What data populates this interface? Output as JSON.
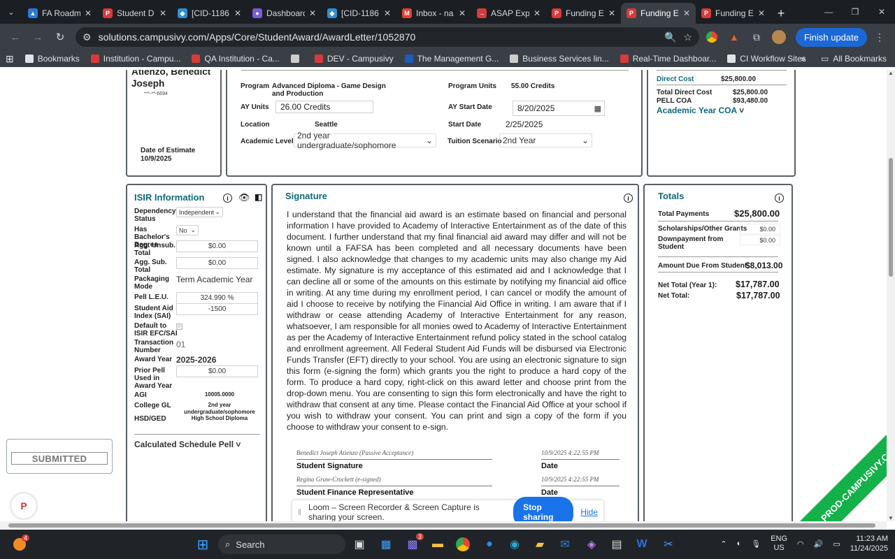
{
  "browser": {
    "tabs": [
      {
        "label": "FA Roadm",
        "color": "#2b7bd6",
        "glyph": "▲"
      },
      {
        "label": "Student D",
        "color": "#d63a3a",
        "glyph": "P"
      },
      {
        "label": "[CID-1186",
        "color": "#2f8fd6",
        "glyph": "◆"
      },
      {
        "label": "Dashboard",
        "color": "#7b5cd6",
        "glyph": "●"
      },
      {
        "label": "[CID-1186",
        "color": "#2f8fd6",
        "glyph": "◆"
      },
      {
        "label": "Inbox - na",
        "color": "#e34133",
        "glyph": "M"
      },
      {
        "label": "ASAP Expr",
        "color": "#d63a3a",
        "glyph": "→"
      },
      {
        "label": "Funding E",
        "color": "#d63a3a",
        "glyph": "P"
      },
      {
        "label": "Funding E",
        "color": "#d63a3a",
        "glyph": "P",
        "active": true
      },
      {
        "label": "Funding E",
        "color": "#d63a3a",
        "glyph": "P"
      }
    ],
    "url": "solutions.campusivy.com/Apps/Core/StudentAward/AwardLetter/1052870",
    "finish_update": "Finish update",
    "bookmarks": [
      {
        "label": "Bookmarks",
        "color": "#e0e3e6"
      },
      {
        "label": "Institution - Campu...",
        "color": "#d63a3a"
      },
      {
        "label": "QA Institution - Ca...",
        "color": "#d63a3a"
      },
      {
        "label": "",
        "color": "#cccccc"
      },
      {
        "label": "DEV - Campusivy",
        "color": "#d63a3a"
      },
      {
        "label": "The Management G...",
        "color": "#1f5bb8"
      },
      {
        "label": "Business Services lin...",
        "color": "#cccccc"
      },
      {
        "label": "Real-Time Dashboar...",
        "color": "#d63a3a"
      },
      {
        "label": "CI Workflow Sites",
        "color": "#e0e3e6"
      }
    ],
    "all_bookmarks": "All Bookmarks"
  },
  "student": {
    "name_line1": "Atienzo, Benedict",
    "name_line2": "Joseph",
    "ssn": "***-**-6694",
    "date_of_estimate_label": "Date of Estimate",
    "date_of_estimate": "10/9/2025"
  },
  "program": {
    "program_label": "Program",
    "program_value": "Advanced Diploma - Game Design and Production",
    "ay_units_label": "AY Units",
    "ay_units_value": "26.00 Credits",
    "location_label": "Location",
    "location_value": "Seattle",
    "academic_level_label": "Academic Level",
    "academic_level_value": "2nd year undergraduate/sophomore",
    "program_units_label": "Program Units",
    "program_units_value": "55.00 Credits",
    "ay_start_label": "AY Start Date",
    "ay_start_value": "8/20/2025",
    "start_date_label": "Start Date",
    "start_date_value": "2/25/2025",
    "tuition_scenario_label": "Tuition Scenario",
    "tuition_scenario_value": "2nd Year"
  },
  "coa": {
    "direct_cost_label": "Direct Cost",
    "direct_cost_value": "$25,800.00",
    "total_direct_cost_label": "Total Direct Cost",
    "total_direct_cost_value": "$25,800.00",
    "pell_coa_label": "PELL COA",
    "pell_coa_value": "$93,480.00",
    "academic_year_coa": "Academic Year COA"
  },
  "isir": {
    "title": "ISIR Information",
    "rows": [
      {
        "label": "Dependency Status",
        "value": "Independent"
      },
      {
        "label": "Has Bachelor's Degree",
        "value": "No"
      },
      {
        "label": "Agg. Unsub. Total",
        "value": "$0.00"
      },
      {
        "label": "Agg. Sub. Total",
        "value": "$0.00"
      },
      {
        "label": "Packaging Mode",
        "value": "Term Academic Year"
      },
      {
        "label": "Pell L.E.U.",
        "value": "324.990 %"
      },
      {
        "label": "Student Aid Index (SAI)",
        "value": "-1500"
      },
      {
        "label": "Default to ISIR EFC/SAI",
        "value": ""
      },
      {
        "label": "Transaction Number",
        "value": "01"
      },
      {
        "label": "Award Year",
        "value": "2025-2026"
      },
      {
        "label": "Prior Pell Used in Award Year",
        "value": "$0.00"
      },
      {
        "label": "AGI",
        "value": "10005.0000"
      },
      {
        "label": "College GL",
        "value": "2nd year undergraduate/sophomore"
      },
      {
        "label": "HSD/GED",
        "value": "High School Diploma"
      }
    ],
    "calculated_schedule": "Calculated Schedule Pell"
  },
  "signature": {
    "title": "Signature",
    "body": "I understand that the financial aid award is an estimate based on financial and personal information I have provided to Academy of Interactive Entertainment as of the date of this document. I further understand that my final financial aid award may differ and will not be known until a FAFSA has been completed and all necessary documents have been signed. I also acknowledge that changes to my academic units may also change my Aid estimate. My signature is my acceptance of this estimated aid and I acknowledge that I can decline all or some of the amounts on this estimate by notifying my financial aid office in writing.  At any time during my enrollment period, I can cancel or modify the amount of aid I choose to receive by notifying the Financial Aid Office in writing.  I am aware that if I withdraw or cease attending Academy of Interactive Entertainment for any reason, whatsoever, I am responsible for all monies owed to Academy of Interactive Entertainment as per the Academy of Interactive Entertainment refund policy stated in the school catalog and enrollment agreement. All Federal Student Aid Funds will be disbursed via Electronic Funds Transfer (EFT) directly to your school.  You are using an electronic signature to sign this form (e-signing the form) which grants you the right to produce a hard copy of the form. To produce a hard copy, right-click on this award letter and choose print from the drop-down menu.  You are consenting to sign this form electronically and have the right to withdraw that consent at any time.  Please contact the Financial Aid Office at your school if you wish to withdraw your consent.  You can print and sign a copy of the form if you choose to withdraw your consent to e-sign.",
    "student_signer": "Benedict Joseph Atienzo (Passive Acceptance)",
    "student_date": "10/9/2025 4:22:55 PM",
    "student_label": "Student Signature",
    "date_label": "Date",
    "rep_signer": "Regina Graw-Crockett (e-signed)",
    "rep_date": "10/9/2025 4:22:55 PM",
    "rep_label": "Student Finance Representative"
  },
  "totals": {
    "title": "Totals",
    "total_payments_label": "Total Payments",
    "total_payments_value": "$25,800.00",
    "scholarships_label": "Scholarships/Other Grants",
    "scholarships_value": "$0.00",
    "downpayment_label": "Downpayment from Student",
    "downpayment_value": "$0.00",
    "amount_due_label": "Amount Due From Student",
    "amount_due_value": "$8,013.00",
    "net_year1_label": "Net Total (Year 1):",
    "net_year1_value": "$17,787.00",
    "net_total_label": "Net Total:",
    "net_total_value": "$17,787.00"
  },
  "submitted": "SUBMITTED",
  "ribbon": "PROD-CAMPUSIVY.COM",
  "loom": {
    "message": "Loom – Screen Recorder & Screen Capture is sharing your screen.",
    "stop": "Stop sharing",
    "hide": "Hide"
  },
  "taskbar": {
    "search": "Search",
    "badge_left": "4",
    "badge_teams": "3",
    "lang_line1": "ENG",
    "lang_line2": "US",
    "time": "11:23 AM",
    "date": "11/24/2025"
  }
}
